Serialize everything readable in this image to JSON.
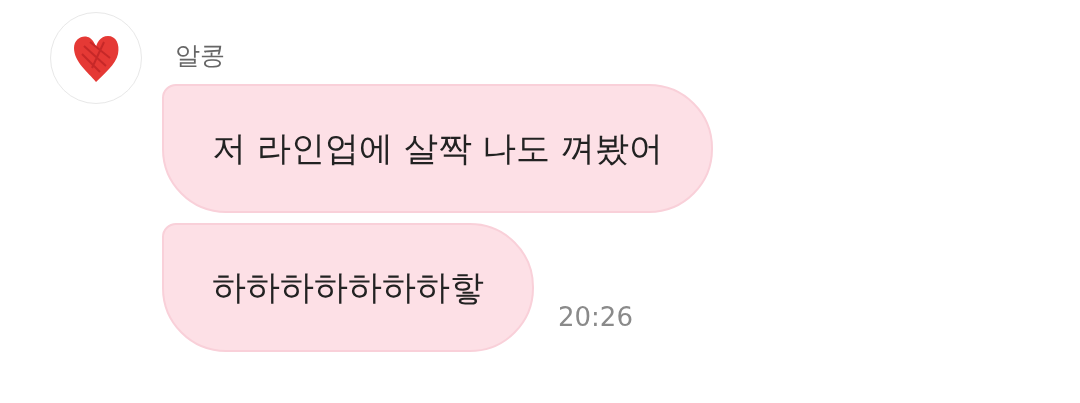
{
  "sender": {
    "name": "알콩"
  },
  "messages": [
    {
      "text": "저 라인업에 살짝 나도 껴봤어"
    },
    {
      "text": "하하하하하하하핳",
      "time": "20:26"
    }
  ]
}
